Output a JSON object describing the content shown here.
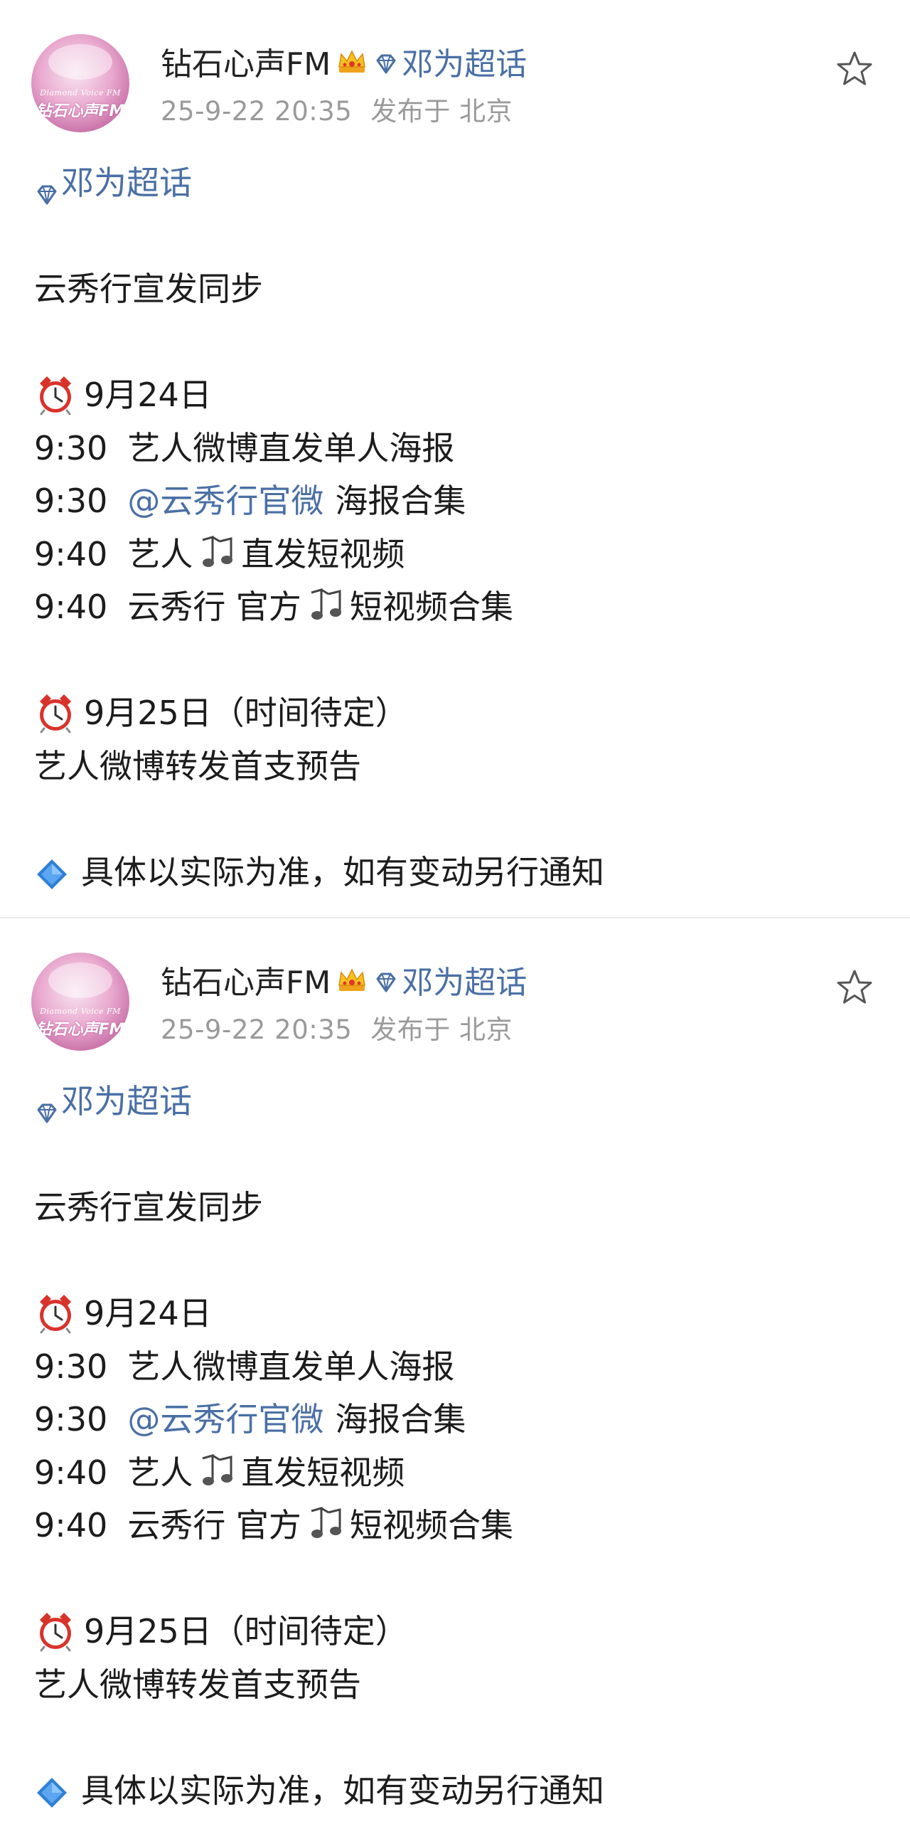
{
  "posts": [
    {
      "author": "钻石心声FM",
      "header_topic": "邓为超话",
      "timestamp": "25-9-22 20:35",
      "location": "发布于 北京",
      "avatar_text_top": "Diamond Voice FM",
      "avatar_text_main": "钻石心声FM",
      "topic_tag": "邓为超话",
      "intro": "云秀行宣发同步",
      "day1_header": "9月24日",
      "day1_lines": [
        {
          "time": "9:30",
          "text": "艺人微博直发单人海报"
        },
        {
          "time": "9:30",
          "mention": "@云秀行官微",
          "text": "海报合集"
        },
        {
          "time": "9:40",
          "pre": "艺人",
          "post": "直发短视频"
        },
        {
          "time": "9:40",
          "pre": "云秀行 官方",
          "post": "短视频合集"
        }
      ],
      "day2_header": "9月25日（时间待定）",
      "day2_text": "艺人微博转发首支预告",
      "note": "具体以实际为准，如有变动另行通知"
    },
    {
      "author": "钻石心声FM",
      "header_topic": "邓为超话",
      "timestamp": "25-9-22 20:35",
      "location": "发布于 北京",
      "avatar_text_top": "Diamond Voice FM",
      "avatar_text_main": "钻石心声FM",
      "topic_tag": "邓为超话",
      "intro": "云秀行宣发同步",
      "day1_header": "9月24日",
      "day1_lines": [
        {
          "time": "9:30",
          "text": "艺人微博直发单人海报"
        },
        {
          "time": "9:30",
          "mention": "@云秀行官微",
          "text": "海报合集"
        },
        {
          "time": "9:40",
          "pre": "艺人",
          "post": "直发短视频"
        },
        {
          "time": "9:40",
          "pre": "云秀行 官方",
          "post": "短视频合集"
        }
      ],
      "day2_header": "9月25日（时间待定）",
      "day2_text": "艺人微博转发首支预告",
      "note": "具体以实际为准，如有变动另行通知"
    }
  ],
  "icons": {
    "crown": "crown-icon",
    "gem": "gem-icon",
    "star": "star-icon",
    "clock": "alarm-clock-icon",
    "music": "music-notes-icon",
    "diamond": "blue-diamond-icon"
  },
  "colors": {
    "link": "#4a6fa5",
    "meta": "#9a9a9a",
    "text": "#1c1c1c",
    "avatar_pink": "#e9a9cf",
    "diamond_blue": "#2f7fd6",
    "clock_red": "#d8332b"
  }
}
